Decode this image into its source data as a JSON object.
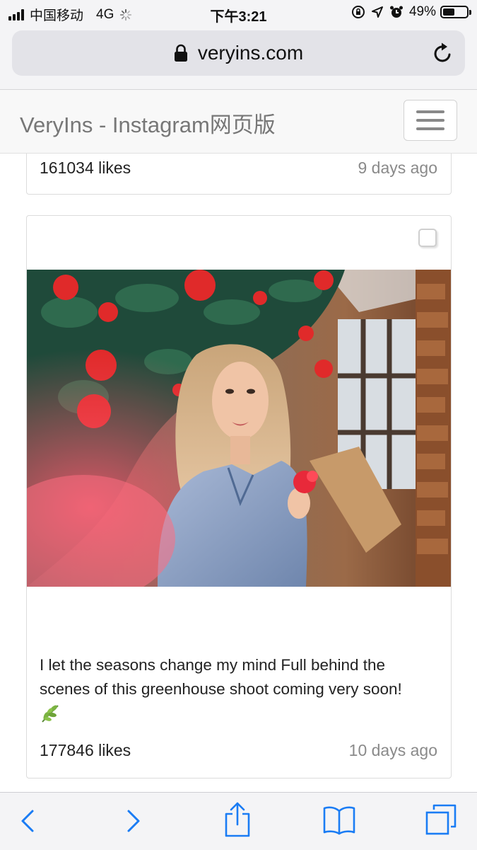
{
  "status_bar": {
    "carrier": "中国移动",
    "network": "4G",
    "time": "下午3:21",
    "battery": "49%"
  },
  "browser": {
    "url": "veryins.com"
  },
  "site": {
    "brand": "VeryIns - Instagram网页版"
  },
  "posts": [
    {
      "likes": "161034 likes",
      "date": "9 days ago"
    },
    {
      "caption": "I let the seasons change my mind Full behind the scenes of this greenhouse shoot coming very soon!",
      "caption_emoji_icon": "herb-leaf-icon",
      "likes": "177846 likes",
      "date": "10 days ago"
    }
  ],
  "toolbar": {
    "icons": [
      "back-icon",
      "forward-icon",
      "share-icon",
      "bookmarks-icon",
      "tabs-icon"
    ],
    "accent_color": "#1a7cf4"
  }
}
